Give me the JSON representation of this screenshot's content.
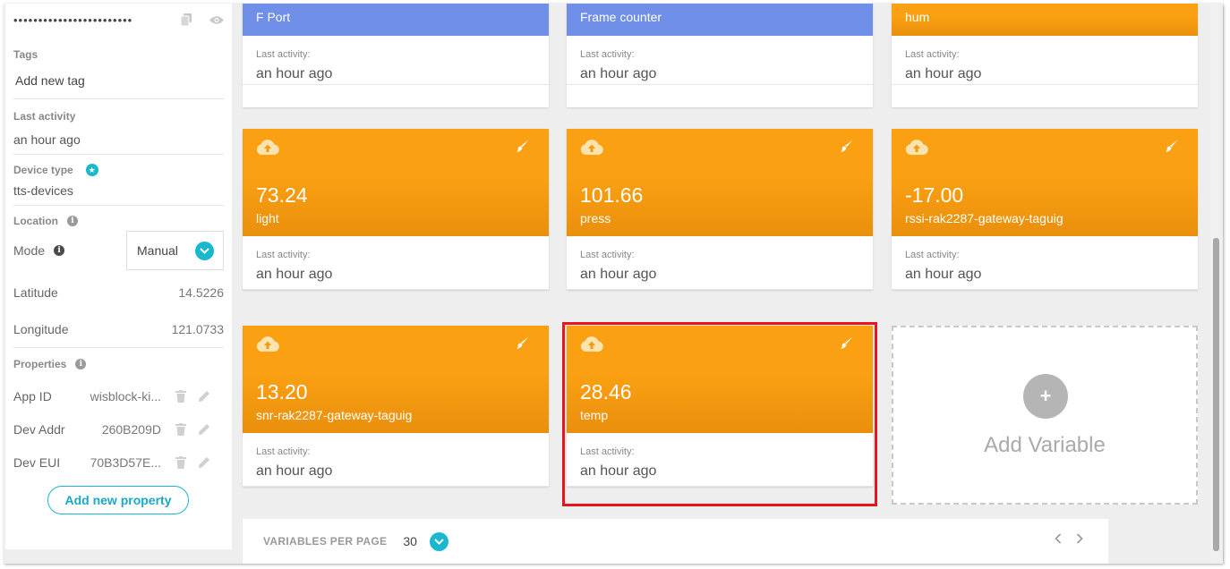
{
  "sidebar": {
    "token": "••••••••••••••••••••••••",
    "tags": {
      "label": "Tags",
      "placeholder": "Add new tag"
    },
    "last_activity": {
      "label": "Last activity",
      "value": "an hour ago"
    },
    "device_type": {
      "label": "Device type",
      "value": "tts-devices"
    },
    "location": {
      "label": "Location",
      "mode_label": "Mode",
      "mode_value": "Manual",
      "latitude_label": "Latitude",
      "latitude_value": "14.5226",
      "longitude_label": "Longitude",
      "longitude_value": "121.0733"
    },
    "properties": {
      "label": "Properties",
      "items": [
        {
          "key": "App ID",
          "value": "wisblock-ki..."
        },
        {
          "key": "Dev Addr",
          "value": "260B209D"
        },
        {
          "key": "Dev EUI",
          "value": "70B3D57E..."
        }
      ],
      "add_label": "Add new property"
    }
  },
  "variables": [
    {
      "name": "F Port",
      "last_activity_label": "Last activity:",
      "last_activity": "an hour ago",
      "color": "#6f8fe8"
    },
    {
      "name": "Frame counter",
      "last_activity_label": "Last activity:",
      "last_activity": "an hour ago",
      "color": "#6f8fe8"
    },
    {
      "name": "hum",
      "last_activity_label": "Last activity:",
      "last_activity": "an hour ago",
      "color": "#faa012"
    },
    {
      "value": "73.24",
      "name": "light",
      "last_activity_label": "Last activity:",
      "last_activity": "an hour ago",
      "color": "#faa012"
    },
    {
      "value": "101.66",
      "name": "press",
      "last_activity_label": "Last activity:",
      "last_activity": "an hour ago",
      "color": "#faa012"
    },
    {
      "value": "-17.00",
      "name": "rssi-rak2287-gateway-taguig",
      "last_activity_label": "Last activity:",
      "last_activity": "an hour ago",
      "color": "#faa012"
    },
    {
      "value": "13.20",
      "name": "snr-rak2287-gateway-taguig",
      "last_activity_label": "Last activity:",
      "last_activity": "an hour ago",
      "color": "#faa012"
    },
    {
      "value": "28.46",
      "name": "temp",
      "last_activity_label": "Last activity:",
      "last_activity": "an hour ago",
      "color": "#faa012"
    }
  ],
  "add_variable": {
    "label": "Add Variable"
  },
  "pager": {
    "label": "VARIABLES PER PAGE",
    "value": "30"
  },
  "colors": {
    "accent": "#19b8cf",
    "highlight": "#e8141e"
  }
}
